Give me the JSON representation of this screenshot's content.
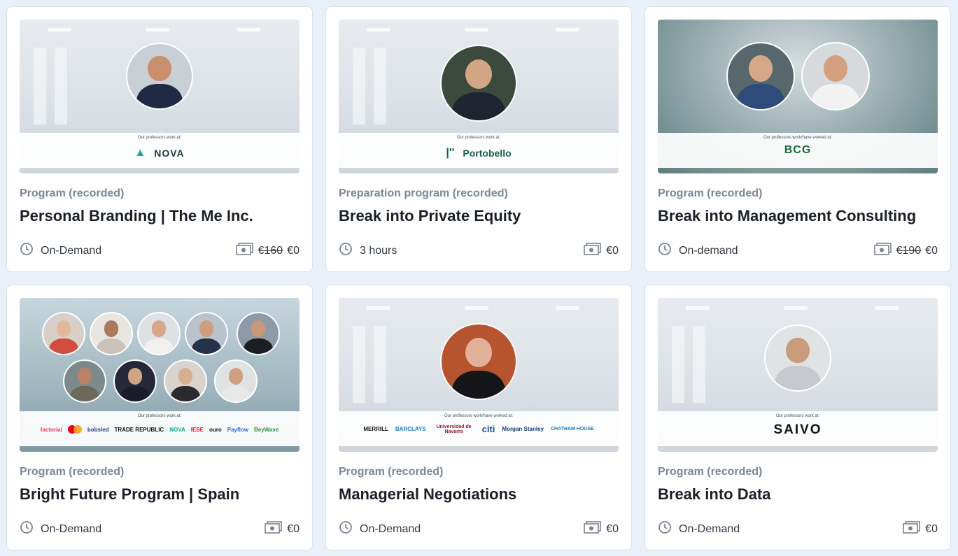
{
  "cards": [
    {
      "category": "Program (recorded)",
      "title": "Personal Branding | The Me Inc.",
      "duration": "On-Demand",
      "old_price": "€160",
      "price": "€0",
      "caption": "Our professors work at:",
      "logo": "NOVA"
    },
    {
      "category": "Preparation program (recorded)",
      "title": "Break into Private Equity",
      "duration": "3 hours",
      "old_price": "",
      "price": "€0",
      "caption": "Our professors work at:",
      "logo": "Portobello"
    },
    {
      "category": "Program (recorded)",
      "title": "Break into Management Consulting",
      "duration": "On-demand",
      "old_price": "€190",
      "price": "€0",
      "caption": "Our professors work/have worked at:",
      "logo": "BCG"
    },
    {
      "category": "Program (recorded)",
      "title": "Bright Future Program | Spain",
      "duration": "On-Demand",
      "old_price": "",
      "price": "€0",
      "caption": "Our professors work at:",
      "logos": [
        "factorial",
        "mastercard",
        "bobsled",
        "TRADE REPUBLIC",
        "NOVA",
        "IESE",
        "ouro",
        "Payflow",
        "BeyWave"
      ]
    },
    {
      "category": "Program (recorded)",
      "title": "Managerial Negotiations",
      "duration": "On-Demand",
      "old_price": "",
      "price": "€0",
      "caption": "Our professors work/have worked at:",
      "logos": [
        "MERRILL",
        "BARCLAYS",
        "Universidad de Navarra",
        "citi",
        "Morgan Stanley",
        "CHATHAM HOUSE"
      ]
    },
    {
      "category": "Program (recorded)",
      "title": "Break into Data",
      "duration": "On-Demand",
      "old_price": "",
      "price": "€0",
      "caption": "Our professors work at:",
      "logo": "SAIVO"
    }
  ],
  "icons": {
    "duration": "clock-icon",
    "price": "money-icon"
  },
  "colors": {
    "nova": "#1fa58e",
    "portobello": "#1b5e4a",
    "bcg": "#1d6a3d",
    "category": "#7c8694"
  }
}
